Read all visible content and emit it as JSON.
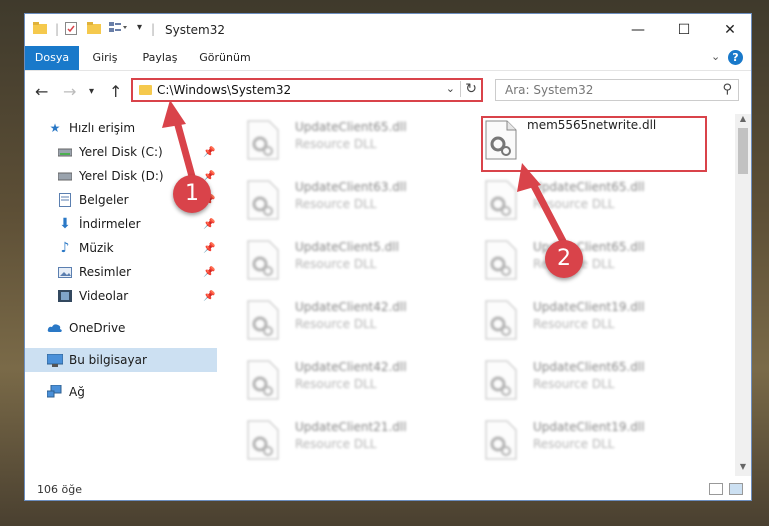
{
  "window": {
    "title": "System32",
    "controls": {
      "minimize": "—",
      "maximize": "☐",
      "close": "✕"
    }
  },
  "ribbon": {
    "tabs": [
      {
        "label": "Dosya",
        "active": true
      },
      {
        "label": "Giriş",
        "active": false
      },
      {
        "label": "Paylaş",
        "active": false
      },
      {
        "label": "Görünüm",
        "active": false
      }
    ],
    "expand_icon": "chevron-down-icon",
    "help_label": "?"
  },
  "addressbar": {
    "path": "C:\\Windows\\System32",
    "search_placeholder": "Ara: System32"
  },
  "nav": {
    "items": [
      {
        "label": "Hızlı erişim",
        "icon": "star-icon",
        "pinned": false
      },
      {
        "label": "Yerel Disk (C:)",
        "icon": "drive-icon",
        "pinned": true
      },
      {
        "label": "Yerel Disk (D:)",
        "icon": "drive-icon",
        "pinned": true
      },
      {
        "label": "Belgeler",
        "icon": "documents-icon",
        "pinned": true
      },
      {
        "label": "İndirmeler",
        "icon": "download-icon",
        "pinned": true
      },
      {
        "label": "Müzik",
        "icon": "music-icon",
        "pinned": true
      },
      {
        "label": "Resimler",
        "icon": "pictures-icon",
        "pinned": true
      },
      {
        "label": "Videolar",
        "icon": "videos-icon",
        "pinned": true
      },
      {
        "label": "OneDrive",
        "icon": "cloud-icon",
        "pinned": false
      },
      {
        "label": "Bu bilgisayar",
        "icon": "computer-icon",
        "pinned": false,
        "selected": true
      },
      {
        "label": "Ağ",
        "icon": "network-icon",
        "pinned": false
      }
    ]
  },
  "files": {
    "left": [
      {
        "name": "UpdateClient65.dll",
        "type": "Resource DLL"
      },
      {
        "name": "UpdateClient63.dll",
        "type": "Resource DLL"
      },
      {
        "name": "UpdateClient5.dll",
        "type": "Resource DLL"
      },
      {
        "name": "UpdateClient42.dll",
        "type": "Resource DLL"
      },
      {
        "name": "UpdateClient42.dll",
        "type": "Resource DLL"
      },
      {
        "name": "UpdateClient21.dll",
        "type": "Resource DLL"
      }
    ],
    "right": [
      {
        "name": "mem5565netwrite.dll",
        "type": "",
        "highlighted": true
      },
      {
        "name": "UpdateClient65.dll",
        "type": "Resource DLL"
      },
      {
        "name": "UpdateClient65.dll",
        "type": "Resource DLL"
      },
      {
        "name": "UpdateClient19.dll",
        "type": "Resource DLL"
      },
      {
        "name": "UpdateClient65.dll",
        "type": "Resource DLL"
      },
      {
        "name": "UpdateClient19.dll",
        "type": "Resource DLL"
      }
    ]
  },
  "status": {
    "item_count": "106 öğe"
  },
  "annotations": {
    "step1": "1",
    "step2": "2",
    "color": "#d9434a"
  }
}
